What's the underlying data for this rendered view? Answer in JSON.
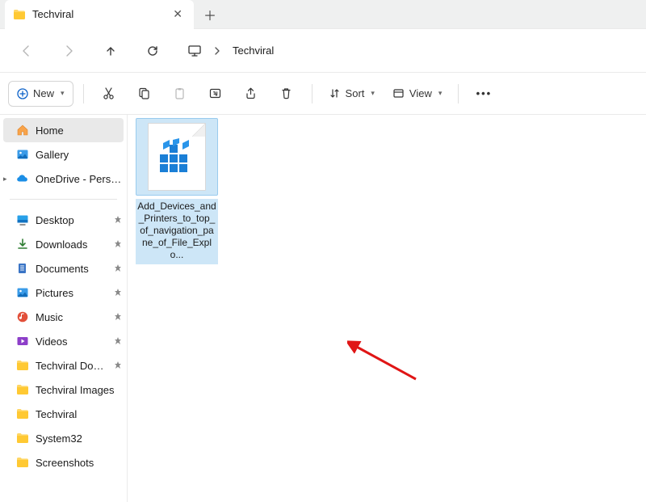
{
  "tab": {
    "title": "Techviral"
  },
  "breadcrumb": {
    "current": "Techviral"
  },
  "toolbar": {
    "new_label": "New",
    "sort_label": "Sort",
    "view_label": "View"
  },
  "sidebar": {
    "home": "Home",
    "gallery": "Gallery",
    "onedrive": "OneDrive - Persona",
    "quick": [
      {
        "label": "Desktop",
        "pinned": true,
        "icon": "desktop"
      },
      {
        "label": "Downloads",
        "pinned": true,
        "icon": "downloads"
      },
      {
        "label": "Documents",
        "pinned": true,
        "icon": "documents"
      },
      {
        "label": "Pictures",
        "pinned": true,
        "icon": "pictures"
      },
      {
        "label": "Music",
        "pinned": true,
        "icon": "music"
      },
      {
        "label": "Videos",
        "pinned": true,
        "icon": "videos"
      },
      {
        "label": "Techviral Docum",
        "pinned": true,
        "icon": "folder"
      },
      {
        "label": "Techviral Images",
        "pinned": false,
        "icon": "folder"
      },
      {
        "label": "Techviral",
        "pinned": false,
        "icon": "folder"
      },
      {
        "label": "System32",
        "pinned": false,
        "icon": "folder"
      },
      {
        "label": "Screenshots",
        "pinned": false,
        "icon": "folder"
      }
    ]
  },
  "files": [
    {
      "name": "Add_Devices_and_Printers_to_top_of_navigation_pane_of_File_Explo..."
    }
  ]
}
